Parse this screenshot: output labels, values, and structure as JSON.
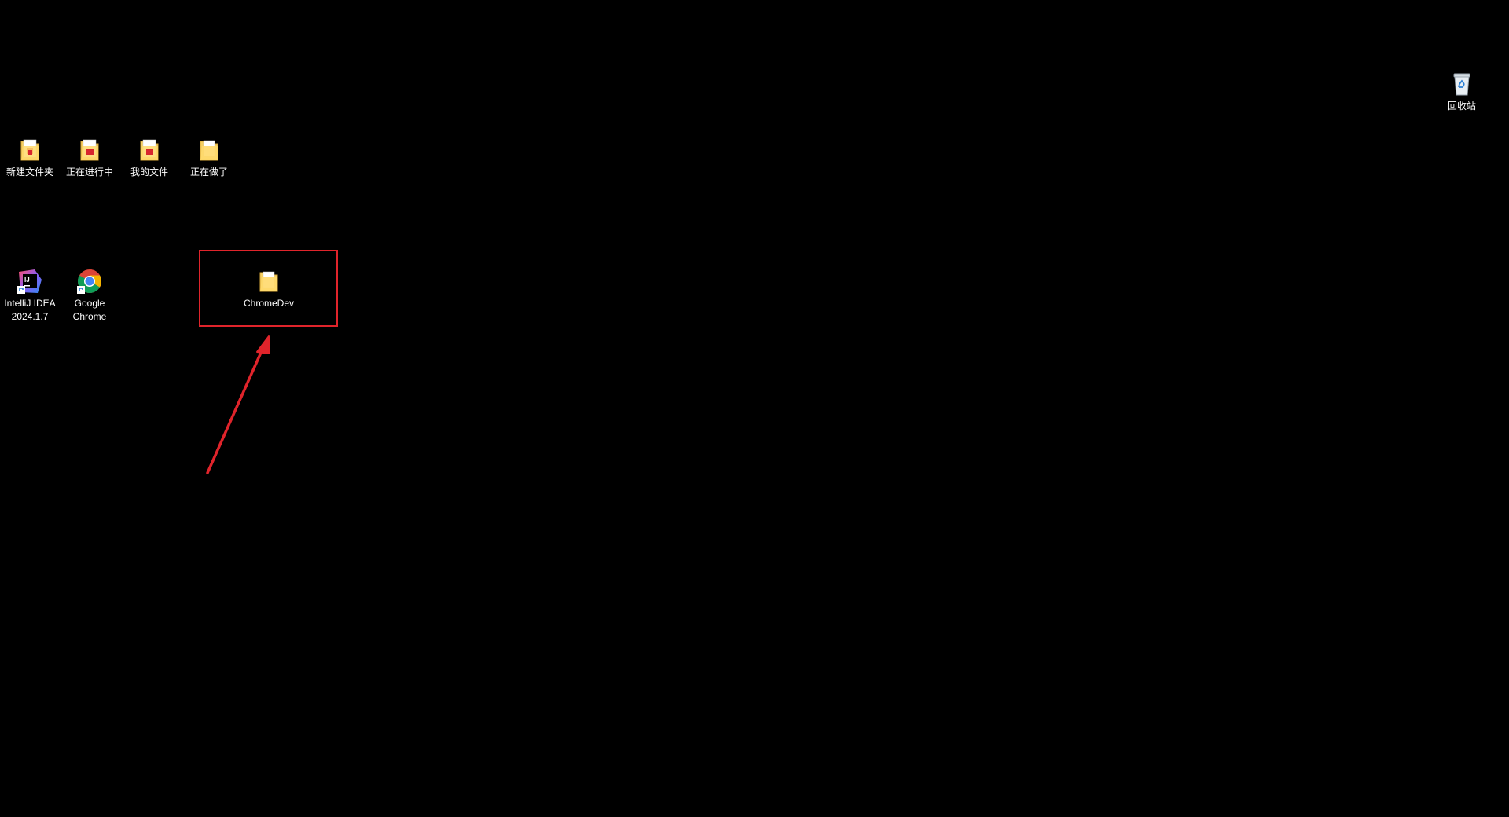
{
  "desktop": {
    "background": "#000000",
    "recycle_bin": {
      "label": "回收站",
      "icon": "recycle-bin-icon"
    },
    "folders_row1": [
      {
        "label": "新建文件夹",
        "icon": "folder-pdf-icon"
      },
      {
        "label": "正在进行中",
        "icon": "folder-pdf-icon"
      },
      {
        "label": "我的文件",
        "icon": "folder-pdf-icon"
      },
      {
        "label": "正在做了",
        "icon": "folder-icon"
      }
    ],
    "apps": [
      {
        "label": "IntelliJ IDEA\n2024.1.7",
        "icon": "intellij-idea-icon"
      },
      {
        "label": "Google\nChrome",
        "icon": "google-chrome-icon"
      }
    ],
    "highlighted_folder": {
      "label": "ChromeDev",
      "icon": "folder-icon"
    }
  },
  "annotation": {
    "box_color": "#e0242b",
    "arrow_color": "#e0242b"
  }
}
